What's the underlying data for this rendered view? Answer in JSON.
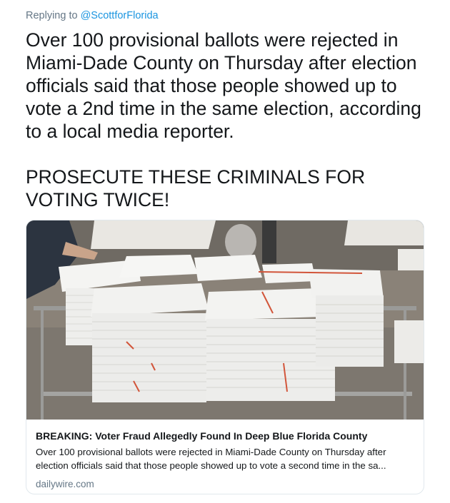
{
  "reply": {
    "prefix": "Replying to",
    "handle": "@ScottforFlorida"
  },
  "tweet": {
    "paragraph1": "Over 100 provisional ballots were rejected in Miami-Dade County on Thursday after election officials said that those people showed up to vote a 2nd time in the same election, according to a local media reporter.",
    "paragraph2": "PROSECUTE THESE CRIMINALS FOR VOTING TWICE!"
  },
  "card": {
    "title": "BREAKING: Voter Fraud Allegedly Found In Deep Blue Florida County",
    "description": "Over 100 provisional ballots were rejected in Miami-Dade County on Thursday after election officials said that those people showed up to vote a second time in the sa...",
    "domain": "dailywire.com",
    "image_subject": "stacks of ballots on a wire cart"
  },
  "colors": {
    "text": "#14171a",
    "link": "#1b95e0",
    "muted": "#657786",
    "border": "#e1e8ed"
  }
}
